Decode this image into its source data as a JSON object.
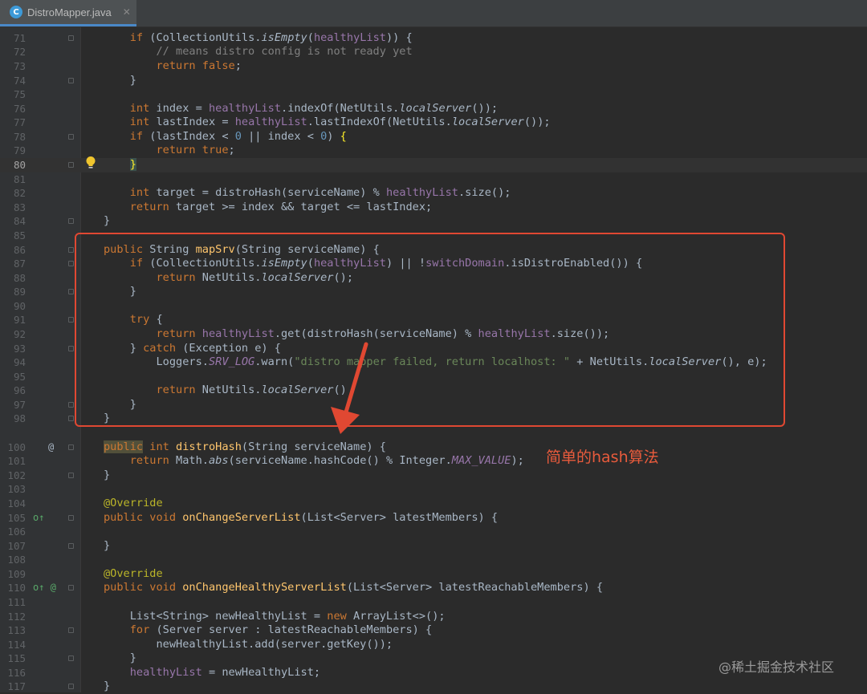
{
  "tab": {
    "icon_letter": "C",
    "file_name": "DistroMapper.java",
    "close_glyph": "✕"
  },
  "lines": [
    {
      "n": "71",
      "html": "    <span class=\"kw\">if</span> (CollectionUtils.<span class=\"it\">isEmpty</span>(<span class=\"fld\">healthyList</span>)) {"
    },
    {
      "n": "72",
      "html": "        <span class=\"cm\">// means distro config is not ready yet</span>"
    },
    {
      "n": "73",
      "html": "        <span class=\"kw\">return false</span>;"
    },
    {
      "n": "74",
      "html": "    }"
    },
    {
      "n": "75",
      "html": ""
    },
    {
      "n": "76",
      "html": "    <span class=\"kw\">int</span> index = <span class=\"fld\">healthyList</span>.indexOf(NetUtils.<span class=\"it\">localServer</span>());"
    },
    {
      "n": "77",
      "html": "    <span class=\"kw\">int</span> lastIndex = <span class=\"fld\">healthyList</span>.lastIndexOf(NetUtils.<span class=\"it\">localServer</span>());"
    },
    {
      "n": "78",
      "html": "    <span class=\"kw\">if</span> (lastIndex &lt; <span class=\"num\">0</span> || index &lt; <span class=\"num\">0</span>) <span style=\"color:#ffef28\">{</span>"
    },
    {
      "n": "79",
      "html": "        <span class=\"kw\">return true</span>;"
    },
    {
      "n": "80",
      "html": "    <span style=\"color:#ffef28;background:#3b514d\">}</span>"
    },
    {
      "n": "81",
      "html": ""
    },
    {
      "n": "82",
      "html": "    <span class=\"kw\">int</span> target = distroHash(serviceName) % <span class=\"fld\">healthyList</span>.size();"
    },
    {
      "n": "83",
      "html": "    <span class=\"kw\">return</span> target &gt;= index &amp;&amp; target &lt;= lastIndex;"
    },
    {
      "n": "84",
      "html": "}"
    },
    {
      "n": "85",
      "html": ""
    },
    {
      "n": "86",
      "html": "<span class=\"kw\">public</span> String <span class=\"fn\">mapSrv</span>(String serviceName) {"
    },
    {
      "n": "87",
      "html": "    <span class=\"kw\">if</span> (CollectionUtils.<span class=\"it\">isEmpty</span>(<span class=\"fld\">healthyList</span>) || !<span class=\"fld\">switchDomain</span>.isDistroEnabled()) {"
    },
    {
      "n": "88",
      "html": "        <span class=\"kw\">return</span> NetUtils.<span class=\"it\">localServer</span>();"
    },
    {
      "n": "89",
      "html": "    }"
    },
    {
      "n": "90",
      "html": ""
    },
    {
      "n": "91",
      "html": "    <span class=\"kw\">try</span> {"
    },
    {
      "n": "92",
      "html": "        <span class=\"kw\">return</span> <span class=\"fld\">healthyList</span>.get(distroHash(serviceName) % <span class=\"fld\">healthyList</span>.size());"
    },
    {
      "n": "93",
      "html": "    } <span class=\"kw\">catch</span> (Exception e) {"
    },
    {
      "n": "94",
      "html": "        Loggers.<span class=\"fld it\">SRV_LOG</span>.warn(<span class=\"str\">\"distro mapper failed, return localhost: \"</span> + NetUtils.<span class=\"it\">localServer</span>(), e);"
    },
    {
      "n": "95",
      "html": ""
    },
    {
      "n": "96",
      "html": "        <span class=\"kw\">return</span> NetUtils.<span class=\"it\">localServer</span>()"
    },
    {
      "n": "97",
      "html": "    }"
    },
    {
      "n": "98",
      "html": "}"
    },
    {
      "n": "",
      "html": ""
    },
    {
      "n": "100",
      "html": "<span class=\"kw hl-pub\">public</span> <span class=\"kw\">int</span> <span class=\"fn\">distroHash</span>(String serviceName) {"
    },
    {
      "n": "101",
      "html": "    <span class=\"kw\">return</span> Math.<span class=\"it\">abs</span>(serviceName.hashCode() % Integer.<span class=\"fld it\">MAX_VALUE</span>);"
    },
    {
      "n": "102",
      "html": "}"
    },
    {
      "n": "103",
      "html": ""
    },
    {
      "n": "104",
      "html": "<span class=\"ann\">@Override</span>"
    },
    {
      "n": "105",
      "html": "<span class=\"kw\">public void</span> <span class=\"fn\">onChangeServerList</span>(List&lt;Server&gt; latestMembers) {"
    },
    {
      "n": "106",
      "html": ""
    },
    {
      "n": "107",
      "html": "}"
    },
    {
      "n": "108",
      "html": ""
    },
    {
      "n": "109",
      "html": "<span class=\"ann\">@Override</span>"
    },
    {
      "n": "110",
      "html": "<span class=\"kw\">public void</span> <span class=\"fn\">onChangeHealthyServerList</span>(List&lt;Server&gt; latestReachableMembers) {"
    },
    {
      "n": "111",
      "html": ""
    },
    {
      "n": "112",
      "html": "    List&lt;String&gt; newHealthyList = <span class=\"kw\">new</span> ArrayList&lt;&gt;();"
    },
    {
      "n": "113",
      "html": "    <span class=\"kw\">for</span> (Server server : latestReachableMembers) {"
    },
    {
      "n": "114",
      "html": "        newHealthyList.add(server.getKey());"
    },
    {
      "n": "115",
      "html": "    }"
    },
    {
      "n": "116",
      "html": "    <span class=\"fld\">healthyList</span> = newHealthyList;"
    },
    {
      "n": "117",
      "html": "}"
    }
  ],
  "current_line": "80",
  "gutter_markers": [
    {
      "line": "100",
      "glyph": "@"
    },
    {
      "line": "105",
      "glyph": "o↑"
    },
    {
      "line": "110",
      "glyph": "o↑ @"
    }
  ],
  "annotation": {
    "text": "简单的hash算法",
    "color": "#e85b3c"
  },
  "watermark": "@稀土掘金技术社区",
  "colors": {
    "background": "#2b2b2b",
    "gutter": "#313335",
    "keyword": "#cc7832",
    "method": "#ffc66d",
    "field": "#9876aa",
    "string": "#6a8759",
    "comment": "#808080",
    "number": "#6897bb",
    "annotation": "#bbb529",
    "highlight_box": "#e04832"
  }
}
